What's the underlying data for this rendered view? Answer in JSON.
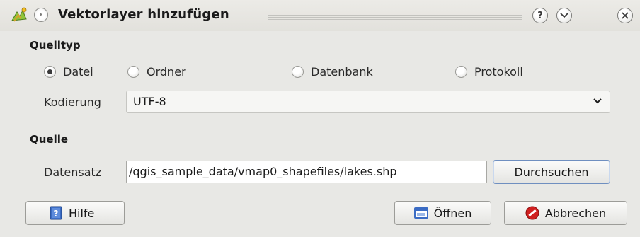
{
  "window": {
    "title": "Vektorlayer hinzufügen",
    "help_glyph": "?",
    "minimize_glyph": "⌄",
    "close_glyph": "×"
  },
  "source_type": {
    "title": "Quelltyp",
    "options": [
      {
        "label": "Datei",
        "checked": true
      },
      {
        "label": "Ordner",
        "checked": false
      },
      {
        "label": "Datenbank",
        "checked": false
      },
      {
        "label": "Protokoll",
        "checked": false
      }
    ],
    "encoding_label": "Kodierung",
    "encoding_value": "UTF-8"
  },
  "source": {
    "title": "Quelle",
    "dataset_label": "Datensatz",
    "dataset_value": "/qgis_sample_data/vmap0_shapefiles/lakes.shp",
    "browse_label": "Durchsuchen"
  },
  "buttons": {
    "help": "Hilfe",
    "open": "Öffnen",
    "cancel": "Abbrechen"
  },
  "icons": {
    "app": "qgis-add-vector-icon",
    "menu": "window-menu-icon",
    "help": "help-book-icon",
    "open": "open-folder-icon",
    "cancel": "cancel-icon"
  },
  "colors": {
    "dialog_bg": "#e8e8e5",
    "accent_blue": "#3b6cc4",
    "cancel_red": "#d02020"
  }
}
